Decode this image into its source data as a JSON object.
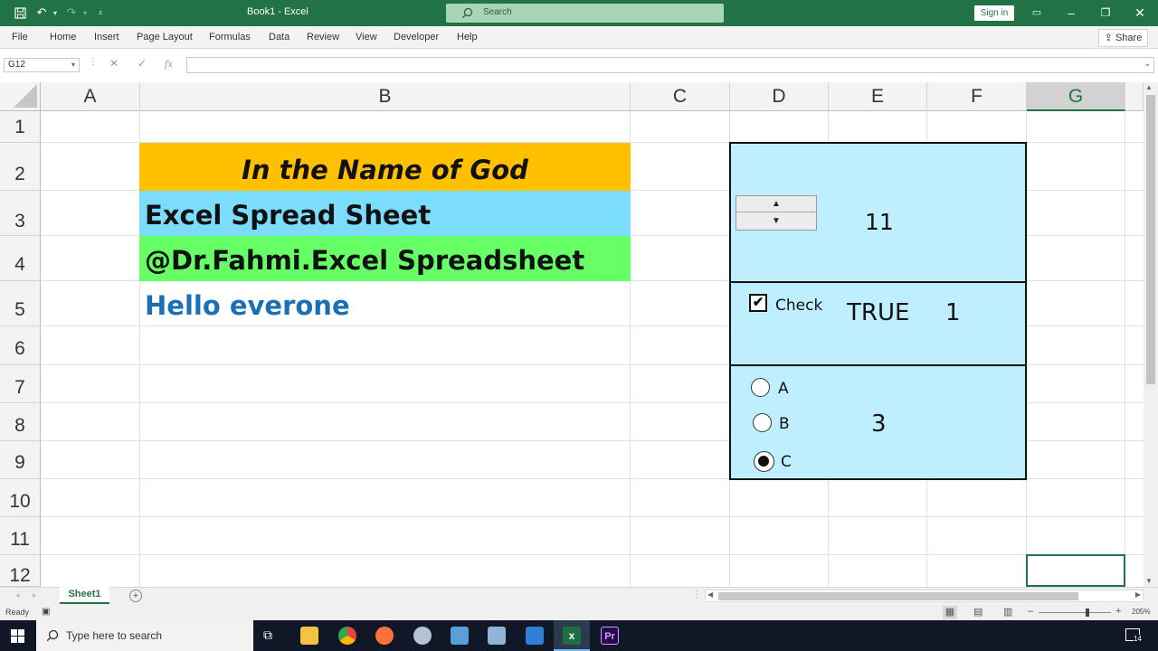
{
  "window": {
    "title": "Book1  -  Excel",
    "search_placeholder": "Search",
    "signin": "Sign in"
  },
  "ribbon": {
    "tabs": [
      "File",
      "Home",
      "Insert",
      "Page Layout",
      "Formulas",
      "Data",
      "Review",
      "View",
      "Developer",
      "Help"
    ],
    "share": "Share"
  },
  "formula_bar": {
    "name_box": "G12",
    "fx": "fx",
    "formula": ""
  },
  "sheet": {
    "columns": [
      "A",
      "B",
      "C",
      "D",
      "E",
      "F",
      "G"
    ],
    "rows": [
      "1",
      "2",
      "3",
      "4",
      "5",
      "6",
      "7",
      "8",
      "9",
      "10",
      "11",
      "12"
    ],
    "selected_column": "G",
    "cells": {
      "B2": "In the Name of God",
      "B3": "Excel Spread Sheet",
      "B4": "@Dr.Fahmi.Excel Spreadsheet",
      "B5": "Hello everone"
    },
    "colors": {
      "B2": "#ffc000",
      "B3": "#7bdcfb",
      "B4": "#66ff66",
      "B5_text": "#1a6fb5",
      "form_bg": "#bfefff",
      "accent": "#217346"
    }
  },
  "controls": {
    "spinner_value": "11",
    "checkbox_label": "Check",
    "checkbox_checked": true,
    "checkbox_value": "TRUE",
    "checkbox_number": "1",
    "radios": [
      "A",
      "B",
      "C"
    ],
    "radio_selected": "C",
    "radio_value": "3"
  },
  "tabs": {
    "sheet": "Sheet1"
  },
  "status": {
    "ready": "Ready",
    "zoom": "205%"
  },
  "taskbar": {
    "search_placeholder": "Type here to search",
    "notifications": "14"
  }
}
